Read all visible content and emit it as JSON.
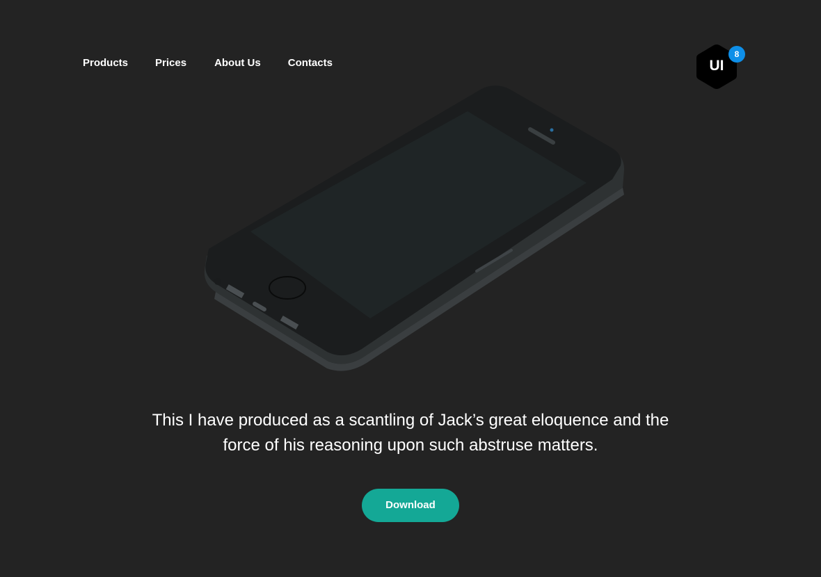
{
  "nav": {
    "items": [
      {
        "label": "Products"
      },
      {
        "label": "Prices"
      },
      {
        "label": "About Us"
      },
      {
        "label": "Contacts"
      }
    ]
  },
  "logo": {
    "text": "UI",
    "badge_count": "8",
    "icon": "hexagon-logo-icon"
  },
  "hero": {
    "image": "phone-mockup-icon",
    "headline": "This I have produced as a scantling of Jack’s great eloquence and the force of his reasoning upon such abstruse matters.",
    "download_label": "Download"
  },
  "colors": {
    "background": "#232323",
    "accent": "#14a896",
    "badge": "#0e8fe8",
    "text": "#ffffff"
  }
}
